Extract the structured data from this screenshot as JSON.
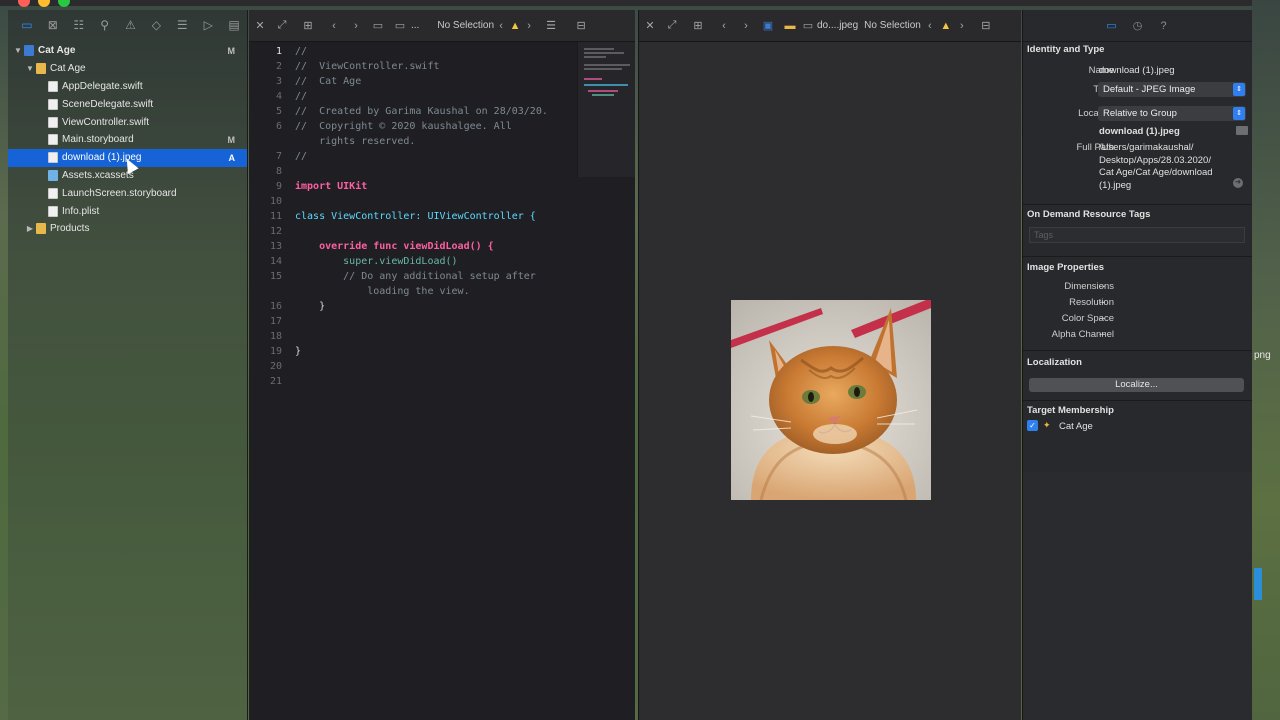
{
  "navigator": {
    "rows": [
      {
        "label": "Cat Age",
        "badge": "M",
        "disclosure": "▼"
      },
      {
        "label": "Cat Age",
        "badge": "",
        "disclosure": "▼"
      },
      {
        "label": "AppDelegate.swift",
        "badge": ""
      },
      {
        "label": "SceneDelegate.swift",
        "badge": ""
      },
      {
        "label": "ViewController.swift",
        "badge": ""
      },
      {
        "label": "Main.storyboard",
        "badge": "M"
      },
      {
        "label": "download (1).jpeg",
        "badge": "A"
      },
      {
        "label": "Assets.xcassets",
        "badge": ""
      },
      {
        "label": "LaunchScreen.storyboard",
        "badge": ""
      },
      {
        "label": "Info.plist",
        "badge": ""
      },
      {
        "label": "Products",
        "badge": "",
        "disclosure": "▶"
      }
    ]
  },
  "editor1": {
    "jumpbar": {
      "selection": "No Selection",
      "crumb": "..."
    },
    "lines": [
      {
        "n": "1",
        "text": "//"
      },
      {
        "n": "2",
        "text": "//  ViewController.swift"
      },
      {
        "n": "3",
        "text": "//  Cat Age"
      },
      {
        "n": "4",
        "text": "//"
      },
      {
        "n": "5",
        "text": "//  Created by Garima Kaushal on 28/03/20."
      },
      {
        "n": "6",
        "text": "//  Copyright © 2020 kaushalgee. All"
      },
      {
        "n": "",
        "text": "    rights reserved."
      },
      {
        "n": "7",
        "text": "//"
      },
      {
        "n": "8",
        "text": ""
      },
      {
        "n": "9",
        "text": "import UIKit"
      },
      {
        "n": "10",
        "text": ""
      },
      {
        "n": "11",
        "text": "class ViewController: UIViewController {"
      },
      {
        "n": "12",
        "text": ""
      },
      {
        "n": "13",
        "text": "    override func viewDidLoad() {"
      },
      {
        "n": "14",
        "text": "        super.viewDidLoad()"
      },
      {
        "n": "15",
        "text": "        // Do any additional setup after"
      },
      {
        "n": "",
        "text": "            loading the view."
      },
      {
        "n": "16",
        "text": "    }"
      },
      {
        "n": "17",
        "text": ""
      },
      {
        "n": "18",
        "text": ""
      },
      {
        "n": "19",
        "text": "}"
      },
      {
        "n": "20",
        "text": ""
      },
      {
        "n": "21",
        "text": ""
      }
    ]
  },
  "editor2": {
    "jumpbar": {
      "file": "do....jpeg",
      "selection": "No Selection"
    },
    "image_alt": "orange tabby cat"
  },
  "inspector": {
    "identity_type": "Identity and Type",
    "name_label": "Name",
    "name_value": "download (1).jpeg",
    "type_label": "Type",
    "type_value": "Default - JPEG Image",
    "location_label": "Location",
    "location_value": "Relative to Group",
    "location_file": "download (1).jpeg",
    "fullpath_label": "Full Path",
    "fullpath_lines": [
      "/Users/garimakaushal/",
      "Desktop/Apps/28.03.2020/",
      "Cat Age/Cat Age/download",
      "(1).jpeg"
    ],
    "on_demand": "On Demand Resource Tags",
    "tags_placeholder": "Tags",
    "image_properties": "Image Properties",
    "dimensions_label": "Dimensions",
    "resolution_label": "Resolution",
    "colorspace_label": "Color Space",
    "alpha_label": "Alpha Channel",
    "empty_value": "--",
    "localization": "Localization",
    "localize_button": "Localize...",
    "target_membership": "Target Membership",
    "target_name": "Cat Age"
  },
  "desktop": {
    "label": "png"
  },
  "colors": {
    "selection": "#1563d6",
    "accent": "#2f8bf5",
    "warning": "#f4c542"
  }
}
